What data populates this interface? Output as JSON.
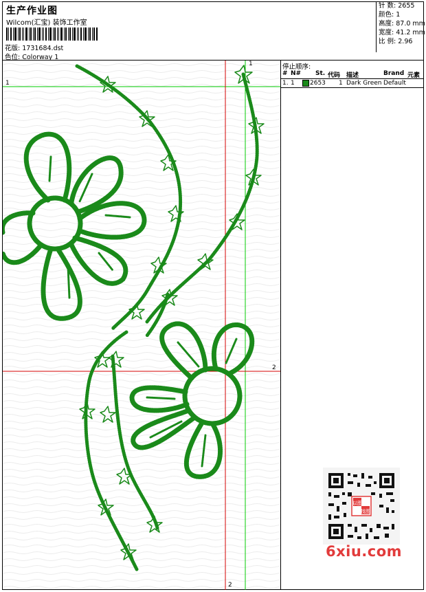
{
  "header": {
    "title": "生产作业图",
    "company": "Wilcom(汇宝) 装饰工作室",
    "design_label": "花版:",
    "design_value": "1731684.dst",
    "color_label": "色位:",
    "color_value": "Colorway 1"
  },
  "stats": [
    {
      "label": "针 数:",
      "value": "2655"
    },
    {
      "label": "颜色:",
      "value": "1"
    },
    {
      "label": "高度:",
      "value": "87.0 mm"
    },
    {
      "label": "宽度:",
      "value": "41.2 mm"
    },
    {
      "label": "比 例:",
      "value": "2.96"
    }
  ],
  "stop_sequence": {
    "title": "停止顺序:",
    "headers": {
      "num": "#",
      "n": "N#",
      "st": "St.",
      "code": "代码",
      "desc": "描述",
      "brand": "Brand",
      "elem": "元素"
    },
    "rows": [
      {
        "num": "1.",
        "n": "1",
        "st": "2653",
        "code": "1",
        "desc": "Dark Green",
        "brand": "Default"
      }
    ]
  },
  "guides": {
    "green_label_left": "1",
    "green_label_top": "1",
    "red_label_right": "2",
    "red_label_bottom": "2"
  },
  "watermark": {
    "text": "6xiu.com",
    "qr_badge": "以图找图"
  },
  "colors": {
    "thread": "#1a8a1a",
    "red_guide": "#d40000",
    "green_guide": "#00cc00",
    "watermark": "#e23b3b"
  }
}
